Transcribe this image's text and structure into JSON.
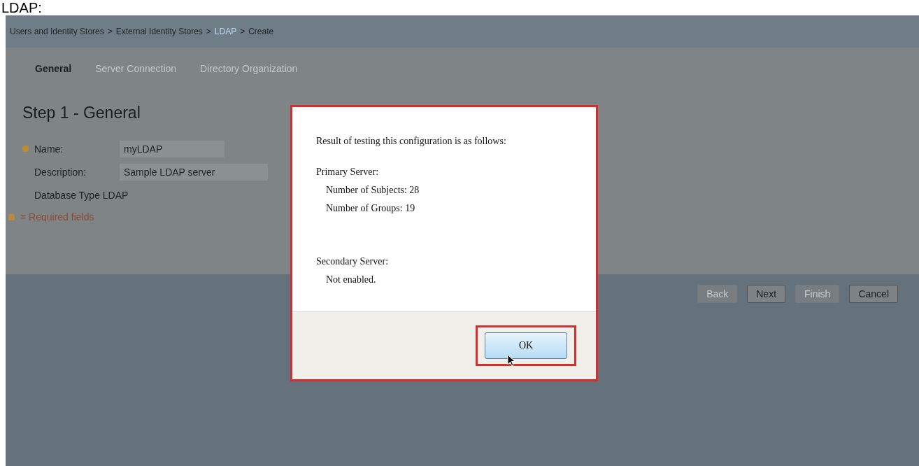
{
  "caption": "LDAP:",
  "breadcrumb": [
    {
      "label": "Users and Identity Stores",
      "link": false
    },
    {
      "label": "External Identity Stores",
      "link": false
    },
    {
      "label": "LDAP",
      "link": true
    },
    {
      "label": "Create",
      "link": false
    }
  ],
  "breadcrumb_separator": ">",
  "tabs": [
    {
      "label": "General",
      "selected": true
    },
    {
      "label": "Server Connection",
      "selected": false
    },
    {
      "label": "Directory Organization",
      "selected": false
    }
  ],
  "step_title": "Step 1 - General",
  "fields": [
    {
      "label": "Name:",
      "value": "myLDAP",
      "required": true,
      "kind": "input"
    },
    {
      "label": "Description:",
      "value": "Sample LDAP server",
      "required": false,
      "kind": "input"
    },
    {
      "label": "Database Type",
      "value": "LDAP",
      "required": false,
      "kind": "text"
    }
  ],
  "required_note": "= Required fields",
  "buttons": [
    {
      "label": "Back",
      "disabled": true
    },
    {
      "label": "Next",
      "disabled": false
    },
    {
      "label": "Finish",
      "disabled": true
    },
    {
      "label": "Cancel",
      "disabled": false
    }
  ],
  "dialog": {
    "intro": "Result of testing this configuration is as follows:",
    "sections": [
      {
        "heading": "Primary Server:",
        "lines": [
          "Number of Subjects: 28",
          "Number of Groups: 19"
        ]
      },
      {
        "heading": "Secondary Server:",
        "lines": [
          "Not enabled."
        ]
      }
    ],
    "ok_button": "OK"
  }
}
